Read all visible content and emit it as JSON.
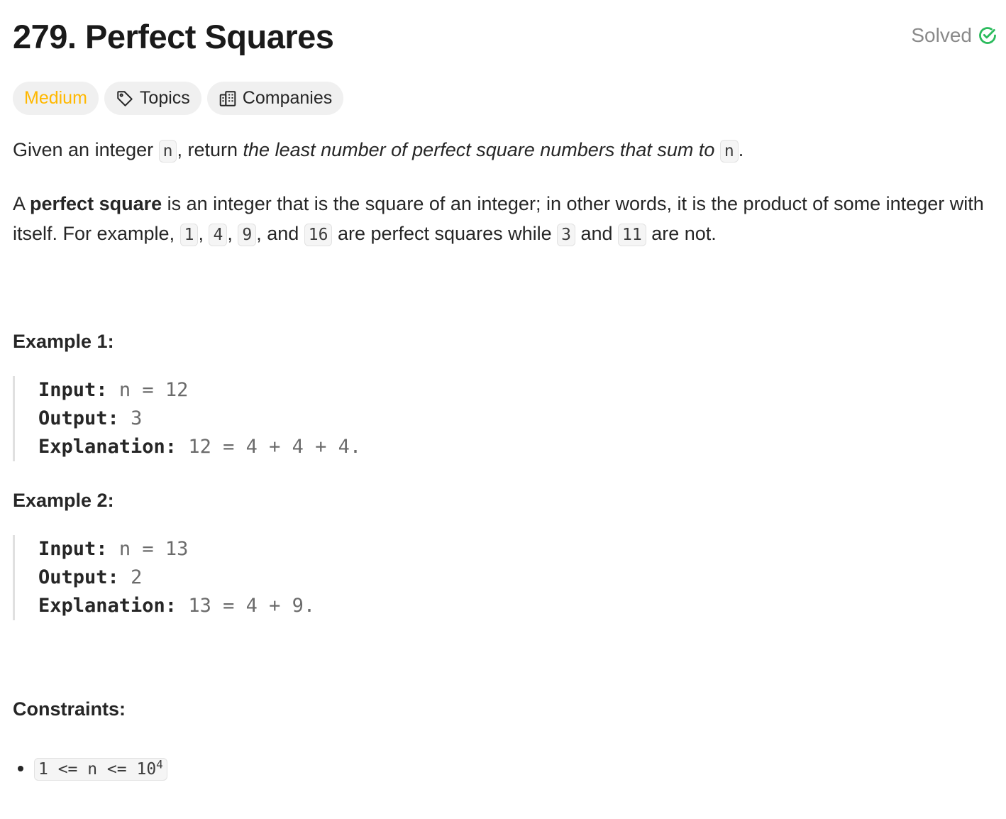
{
  "header": {
    "title": "279. Perfect Squares",
    "status": "Solved",
    "status_color": "#2cbb5d"
  },
  "tags": {
    "difficulty": "Medium",
    "difficulty_color": "#ffb800",
    "topics": "Topics",
    "companies": "Companies"
  },
  "description": {
    "p1_a": "Given an integer ",
    "p1_code1": "n",
    "p1_b": ", return ",
    "p1_italic": "the least number of perfect square numbers that sum to",
    "p1_code2": "n",
    "p1_c": ".",
    "p2_a": "A ",
    "p2_bold": "perfect square",
    "p2_b": " is an integer that is the square of an integer; in other words, it is the product of some integer with itself. For example, ",
    "p2_codes": [
      "1",
      "4",
      "9",
      "16",
      "3",
      "11"
    ],
    "p2_sep1": ", ",
    "p2_sep2": ", ",
    "p2_sep3": ", and ",
    "p2_c": " are perfect squares while ",
    "p2_d": " and ",
    "p2_e": " are not."
  },
  "examples": [
    {
      "title": "Example 1:",
      "input_label": "Input:",
      "input": "n = 12",
      "output_label": "Output:",
      "output": "3",
      "explanation_label": "Explanation:",
      "explanation": "12 = 4 + 4 + 4."
    },
    {
      "title": "Example 2:",
      "input_label": "Input:",
      "input": "n = 13",
      "output_label": "Output:",
      "output": "2",
      "explanation_label": "Explanation:",
      "explanation": "13 = 4 + 9."
    }
  ],
  "constraints": {
    "title": "Constraints:",
    "items": [
      {
        "base": "1 <= n <= 10",
        "exp": "4"
      }
    ]
  }
}
